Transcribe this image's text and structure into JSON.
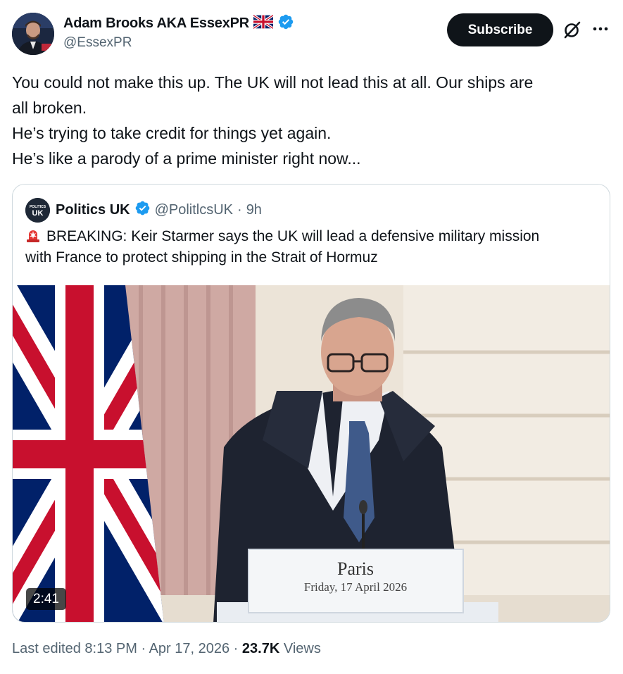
{
  "author": {
    "name": "Adam Brooks AKA EssexPR",
    "handle": "@EssexPR",
    "flag_icon": "uk-flag-icon",
    "verified_icon": "verified-badge-icon",
    "verified_color": "#1d9bf0"
  },
  "actions": {
    "subscribe_label": "Subscribe",
    "grok_icon": "grok-icon",
    "more_icon": "more-icon"
  },
  "tweet": {
    "lines": [
      "You could not make this up. The UK will not lead this at all. Our ships are",
      "all broken.",
      "He’s trying to take credit for things yet again.",
      "He’s like a parody of a prime minister right now..."
    ]
  },
  "quoted": {
    "name": "Politics UK",
    "handle": "@PolitlcsUK",
    "separator": "·",
    "time": "9h",
    "avatar_text_top": "POLITICS",
    "avatar_text_bottom": "UK",
    "text_line1": "BREAKING: Keir Starmer says the UK will lead a defensive military mission",
    "text_line2": "with France to protect shipping in the Strait of Hormuz",
    "video": {
      "duration": "2:41",
      "lectern_title": "Paris",
      "lectern_date": "Friday, 17 April 2026"
    }
  },
  "meta": {
    "edited": "Last edited 8:13 PM",
    "sep1": "·",
    "date": "Apr 17, 2026",
    "sep2": "·",
    "views_count": "23.7K",
    "views_label": "Views"
  }
}
